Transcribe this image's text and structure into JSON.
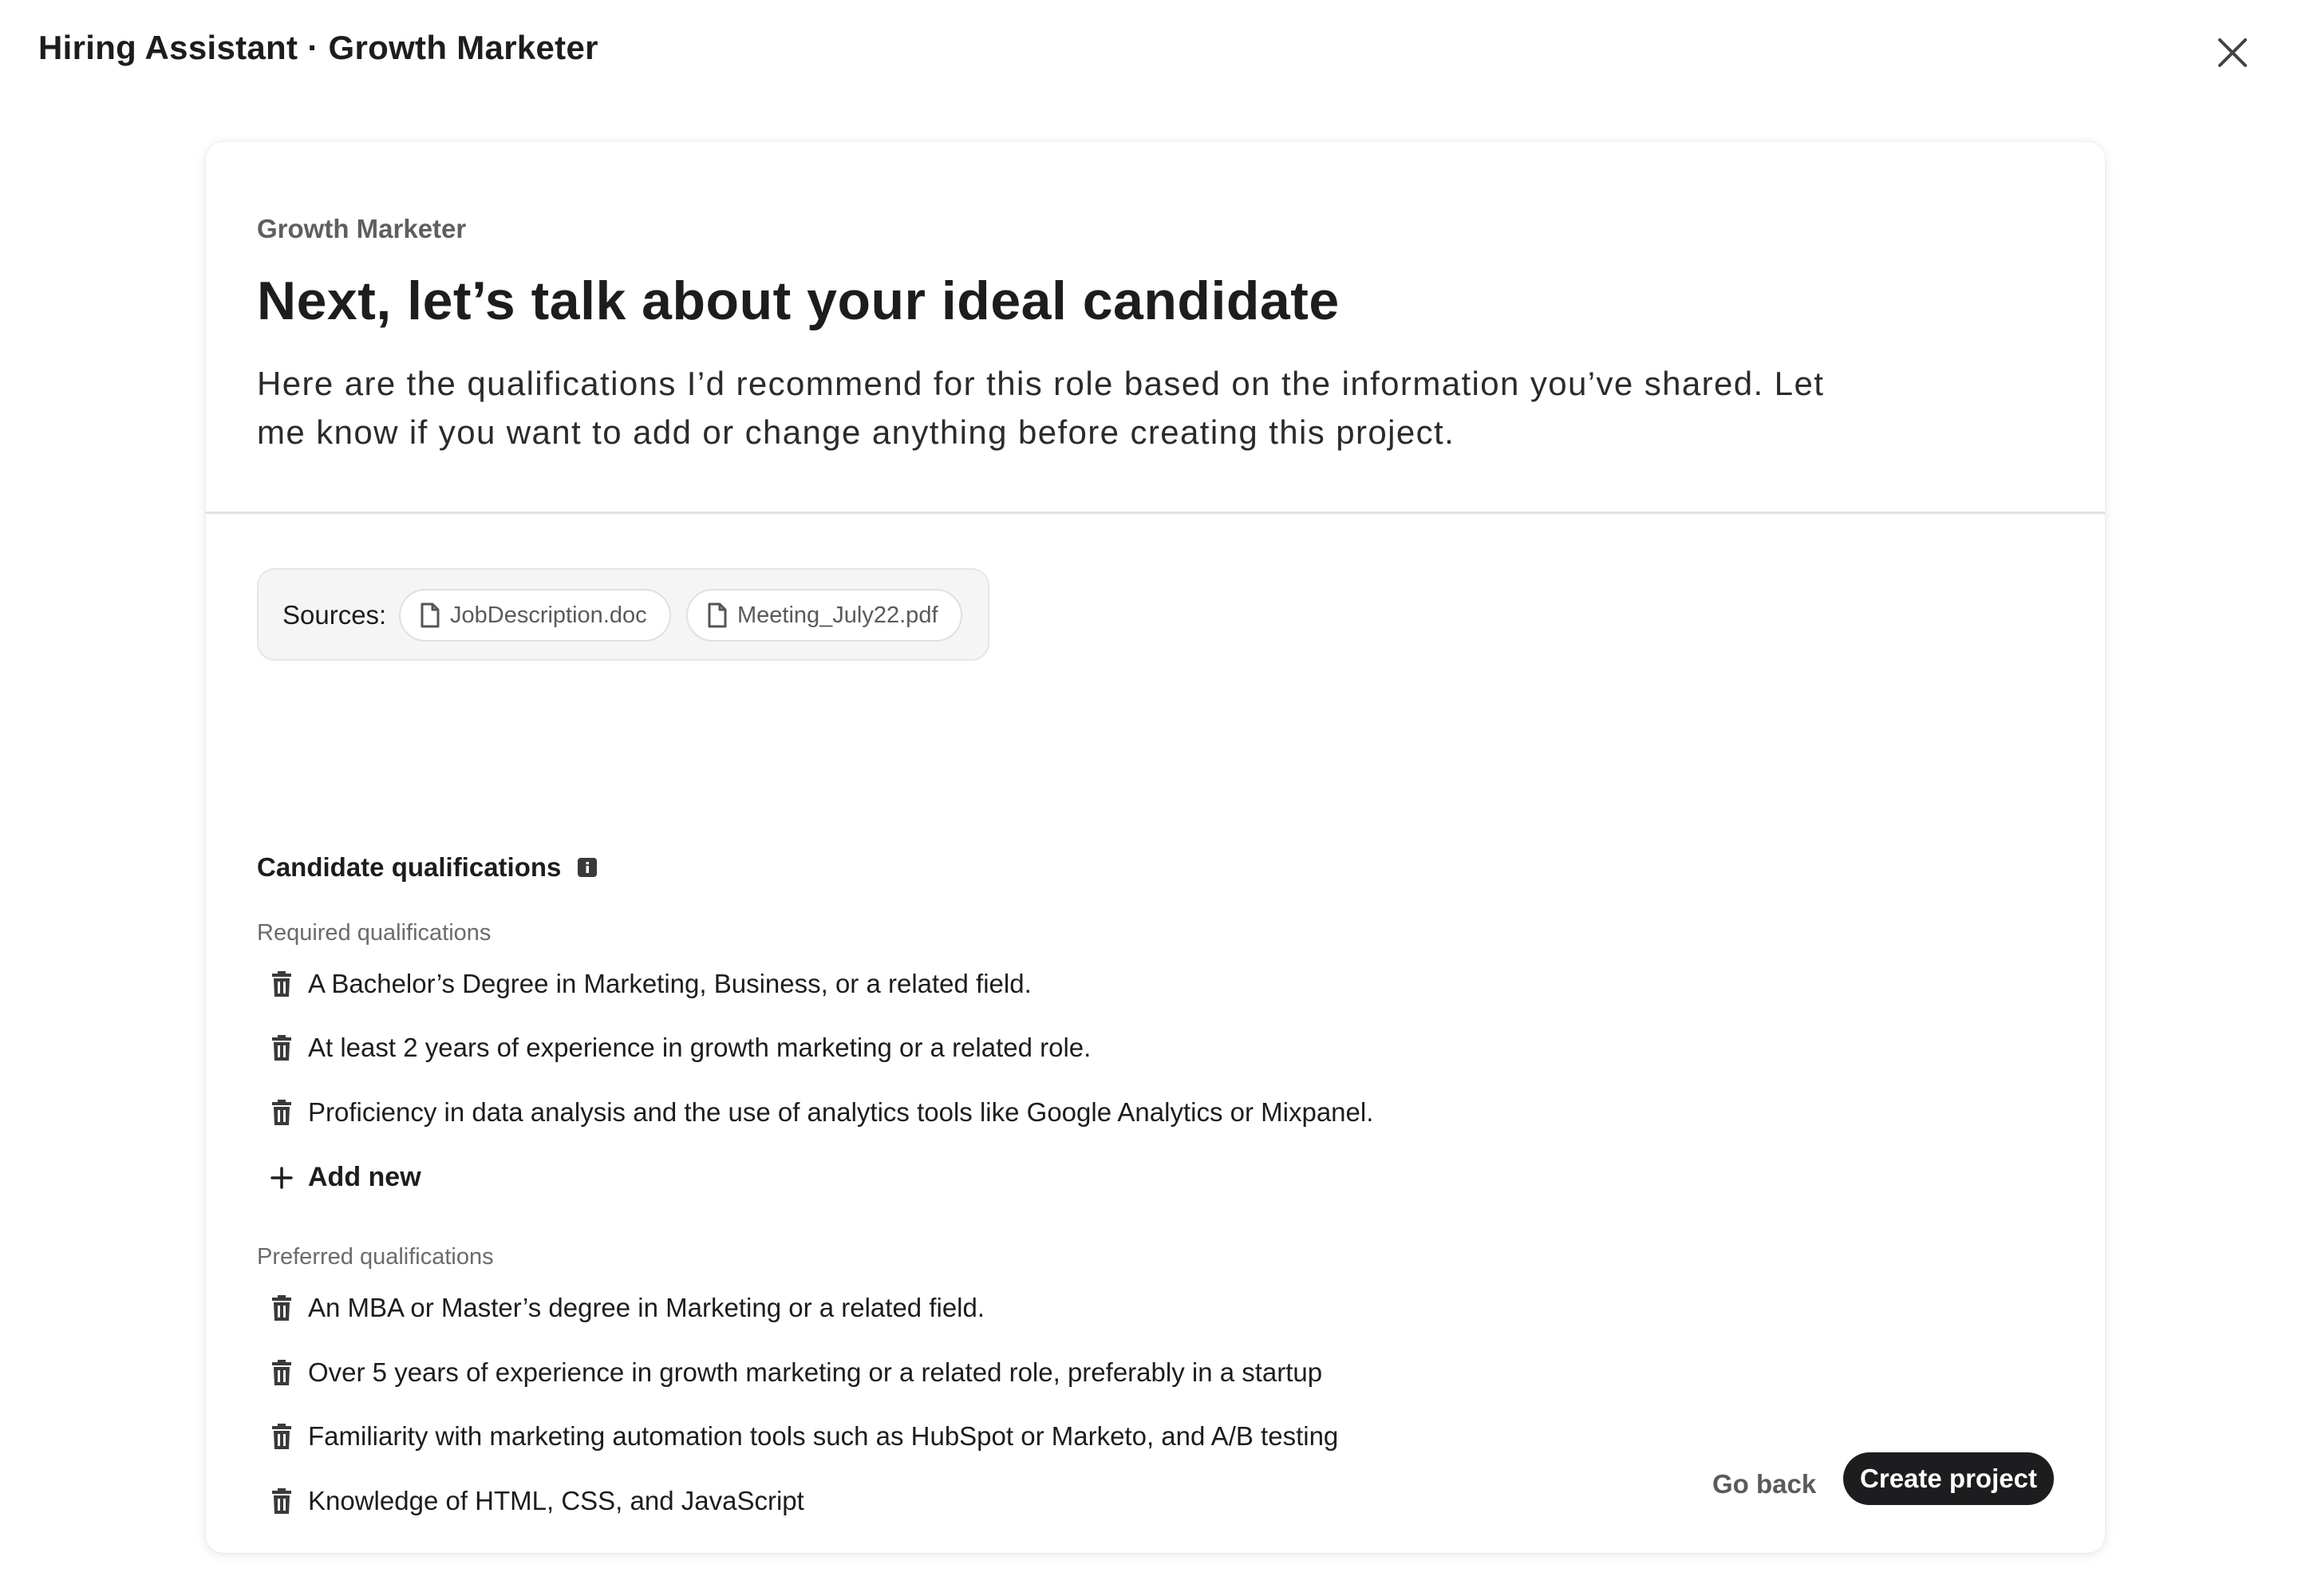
{
  "header": {
    "title": "Hiring Assistant · Growth Marketer",
    "close_icon": "close-icon"
  },
  "card": {
    "role": "Growth Marketer",
    "headline": "Next, let’s talk about your ideal candidate",
    "intro": "Here are the qualifications I’d recommend for this role based on the information you’ve shared. Let me know if you want to add or change anything before creating this project."
  },
  "sources": {
    "label": "Sources:",
    "files": [
      {
        "name": "JobDescription.doc",
        "icon": "file-icon"
      },
      {
        "name": "Meeting_July22.pdf",
        "icon": "file-icon"
      }
    ]
  },
  "qualifications": {
    "title": "Candidate qualifications",
    "info_icon": "info-icon",
    "required_label": "Required qualifications",
    "required": [
      "A Bachelor’s Degree in Marketing, Business, or a related field.",
      "At least 2 years of experience in growth marketing or a related role.",
      "Proficiency in data analysis and the use of analytics tools like Google Analytics or Mixpanel."
    ],
    "add_new_label": "Add new",
    "preferred_label": "Preferred qualifications",
    "preferred": [
      "An MBA or Master’s degree in Marketing or a related field.",
      "Over 5 years of experience in growth marketing or a related role, preferably in a startup",
      "Familiarity with marketing automation tools such as HubSpot or Marketo, and A/B testing",
      "Knowledge of HTML, CSS, and JavaScript"
    ]
  },
  "footer": {
    "go_back_label": "Go back",
    "create_label": "Create project"
  },
  "colors": {
    "primary_button": "#1d1d1f",
    "muted_text": "#6b6b6b"
  }
}
